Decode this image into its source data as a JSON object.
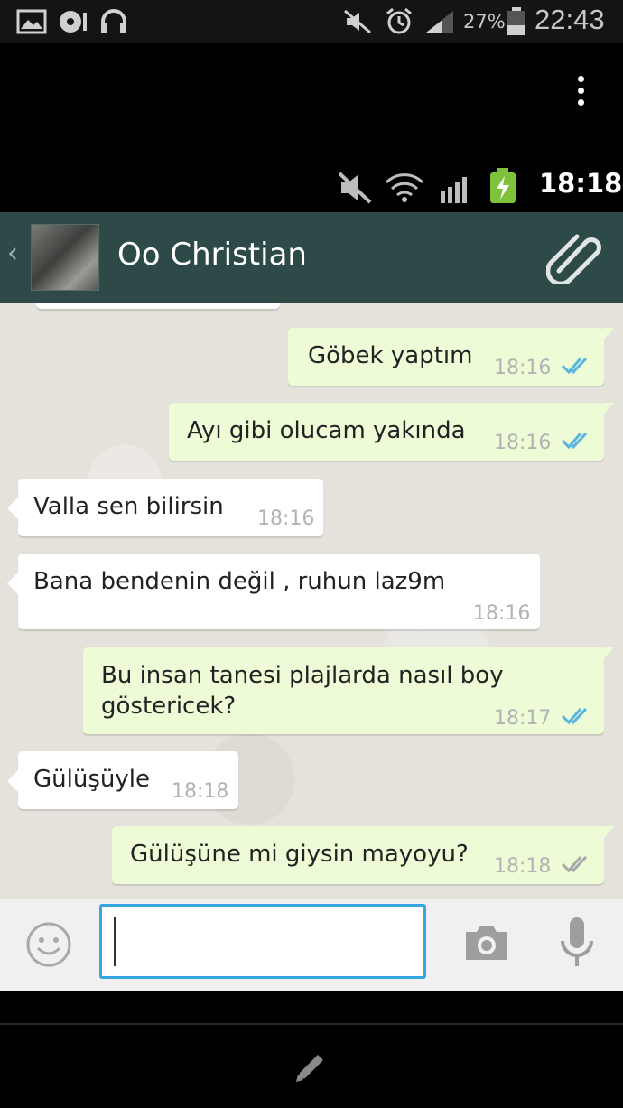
{
  "outer_status": {
    "battery_pct": "27%",
    "time": "22:43",
    "icons": [
      "image-icon",
      "media-icon",
      "headset-icon",
      "mute-icon",
      "alarm-icon",
      "signal-icon",
      "battery-icon"
    ]
  },
  "viewer": {
    "menu_icon": "overflow-menu-icon"
  },
  "inner_status": {
    "time": "18:18",
    "icons": [
      "mute-icon",
      "wifi-icon",
      "signal-icon",
      "battery-charging-icon"
    ]
  },
  "header": {
    "contact_name": "Oo Christian",
    "icons": [
      "back-chevron-icon",
      "attach-icon"
    ]
  },
  "messages": [
    {
      "dir": "out",
      "text": "Göbek yaptım",
      "time": "18:16",
      "status": "read"
    },
    {
      "dir": "out",
      "text": "Ayı gibi olucam yakında",
      "time": "18:16",
      "status": "read"
    },
    {
      "dir": "in",
      "text": "Valla sen bilirsin",
      "time": "18:16"
    },
    {
      "dir": "in",
      "text": "Bana bendenin değil ,  ruhun laz9m",
      "time": "18:16"
    },
    {
      "dir": "out",
      "text_line1": "Bu insan tanesi plajlarda nasıl boy",
      "text_line2": "göstericek?",
      "time": "18:17",
      "status": "read"
    },
    {
      "dir": "in",
      "text": "Gülüşüyle",
      "time": "18:18"
    },
    {
      "dir": "out",
      "text": "Gülüşüne mi giysin mayoyu?",
      "time": "18:18",
      "status": "delivered"
    }
  ],
  "input_bar": {
    "value": "",
    "icons": [
      "emoji-icon",
      "camera-icon",
      "microphone-icon"
    ]
  },
  "bottom_bar": {
    "icon": "edit-pencil-icon"
  },
  "colors": {
    "header_bg": "#2d4a48",
    "outgoing_bubble": "#eefbd7",
    "incoming_bubble": "#ffffff",
    "read_check": "#5ab4e0",
    "input_border": "#36a6e2"
  }
}
